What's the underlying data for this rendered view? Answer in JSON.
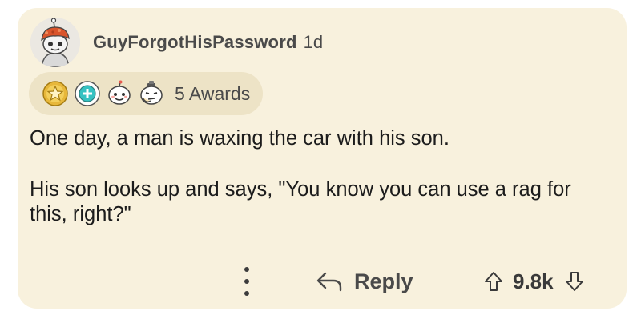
{
  "comment": {
    "username": "GuyForgotHisPassword",
    "timestamp": "1d",
    "awards_label": "5 Awards",
    "award_icons": [
      "gold-award-icon",
      "helpful-award-icon",
      "wholesome-award-icon",
      "thinking-face-award-icon"
    ],
    "paragraphs": [
      "One day, a man is waxing the car with his son.",
      "His son looks up and says, \"You know you can use a rag for this, right?\""
    ],
    "actions": {
      "more_icon": "vertical-ellipsis-icon",
      "reply_label": "Reply",
      "reply_icon": "reply-arrow-icon",
      "score": "9.8k",
      "upvote_icon": "upvote-arrow-icon",
      "downvote_icon": "downvote-arrow-icon"
    }
  },
  "colors": {
    "card_background": "#f8f1dd",
    "awards_pill": "#ede3c6",
    "meta_text": "#4a4a4a",
    "body_text": "#1c1c1c"
  }
}
